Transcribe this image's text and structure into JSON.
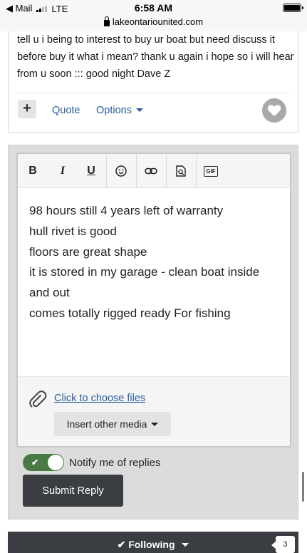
{
  "status_bar": {
    "back_app": "◀ Mail",
    "network": "LTE",
    "time": "6:58 AM",
    "url": "lakeontariounited.com"
  },
  "post": {
    "text": "tell u i being to interest to buy ur boat but need discuss it before buy it what i mean? thank u again  i hope so i will hear from u soon ::: good night Dave Z",
    "plus_label": "+",
    "quote_label": "Quote",
    "options_label": "Options"
  },
  "editor": {
    "toolbar": {
      "bold": "B",
      "italic": "I",
      "underline": "U",
      "gif": "GIF"
    },
    "lines": [
      "98 hours still 4 years left of warranty",
      "hull rivet is good",
      "floors are great shape",
      "it is stored in my garage - clean boat inside and out",
      "comes totally rigged ready For fishing"
    ],
    "choose_files": "Click to choose files",
    "insert_media": "Insert other media"
  },
  "notify": {
    "label": "Notify me of replies",
    "enabled": true
  },
  "submit_label": "Submit Reply",
  "footer": {
    "following_label": "Following",
    "count": "3"
  },
  "colors": {
    "link": "#2a5f9e",
    "toggle_on": "#4a7a44",
    "dark_button": "#3a3d42"
  }
}
